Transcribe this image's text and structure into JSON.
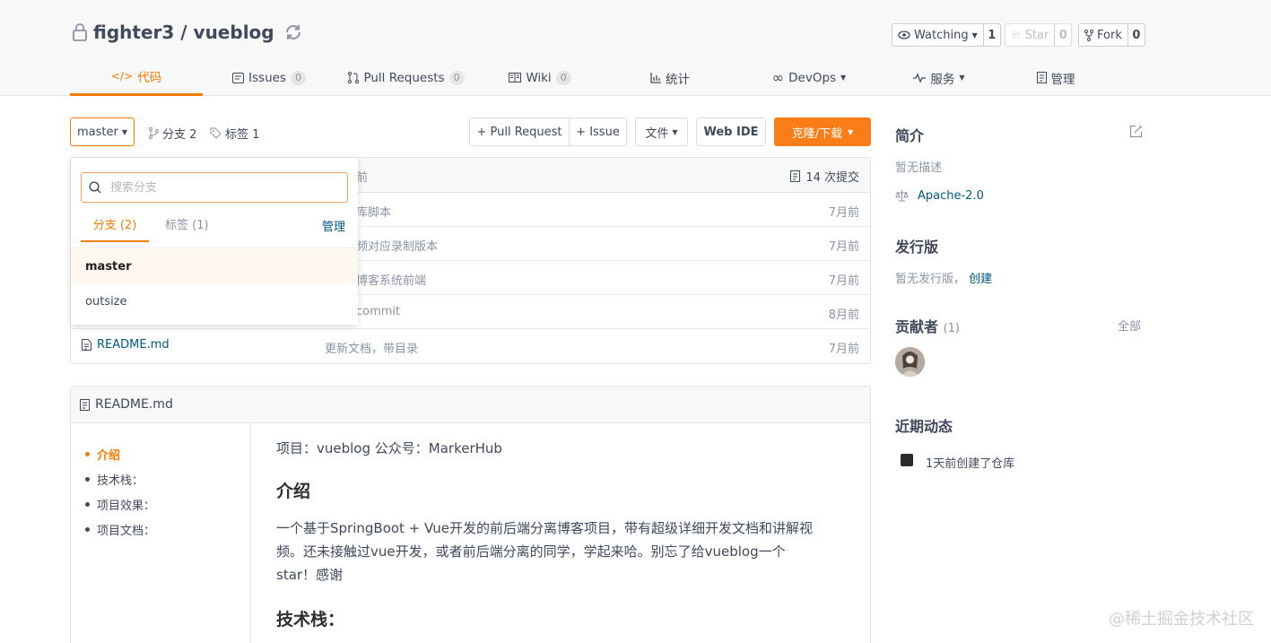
{
  "repo": {
    "owner": "fighter3",
    "separator": " / ",
    "name": "vueblog"
  },
  "actions": {
    "watch": {
      "label": "Watching",
      "count": "1"
    },
    "star": {
      "label": "Star",
      "count": "0"
    },
    "fork": {
      "label": "Fork",
      "count": "0"
    }
  },
  "tabs": [
    {
      "label": "代码"
    },
    {
      "label": "Issues",
      "badge": "0"
    },
    {
      "label": "Pull Requests",
      "badge": "0"
    },
    {
      "label": "Wiki",
      "badge": "0"
    },
    {
      "label": "统计"
    },
    {
      "label": "DevOps"
    },
    {
      "label": "服务"
    },
    {
      "label": "管理"
    }
  ],
  "toolbar": {
    "branch": "master",
    "branches_label": "分支 2",
    "tags_label": "标签 1",
    "pull_request": "+ Pull Request",
    "issue": "+ Issue",
    "files": "文件",
    "web_ide": "Web IDE",
    "clone": "克隆/下载"
  },
  "files": {
    "head_msg": "前",
    "commits": "14 次提交",
    "rows": [
      {
        "name": "",
        "msg": "库脚本",
        "time": "7月前"
      },
      {
        "name": "",
        "msg": "频对应录制版本",
        "time": "7月前"
      },
      {
        "name": "",
        "msg": "博客系统前端",
        "time": "7月前"
      },
      {
        "name": "",
        "msg": "commit",
        "time": "8月前"
      },
      {
        "name": "README.md",
        "msg": "更新文档，带目录",
        "time": "7月前"
      }
    ]
  },
  "dropdown": {
    "placeholder": "搜索分支",
    "tab_branches": "分支 (2)",
    "tab_tags": "标签 (1)",
    "manage": "管理",
    "items": [
      "master",
      "outsize"
    ]
  },
  "readme": {
    "title": "README.md",
    "toc": [
      "介绍",
      "技术栈：",
      "项目效果：",
      "项目文档："
    ],
    "intro_line": "项目：vueblog 公众号：MarkerHub",
    "h_intro": "介绍",
    "desc_1": "一个基于SpringBoot + Vue开发的前后端分离博客项目，带有超级详细开发文档和讲解视",
    "desc_2": "频。还未接触过vue开发，或者前后端分离的同学，学起来哈。别忘了给vueblog一个",
    "desc_3": "star！感谢",
    "h_stack": "技术栈："
  },
  "sidebar": {
    "intro_title": "简介",
    "intro_text": "暂无描述",
    "license": "Apache-2.0",
    "release_title": "发行版",
    "release_text": "暂无发行版，",
    "release_link": "创建",
    "contrib_title": "贡献者",
    "contrib_count": "(1)",
    "contrib_all": "全部",
    "activity_title": "近期动态",
    "activity_text": "1天前创建了仓库"
  },
  "watermark": "@稀土掘金技术社区",
  "colors": {
    "accent": "#f57c00",
    "link": "#005980",
    "clone_bg": "#fa7d17"
  }
}
